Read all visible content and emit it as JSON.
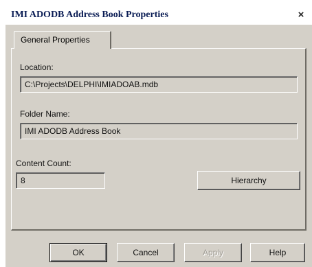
{
  "window": {
    "title": "IMI ADODB Address Book Properties",
    "close_glyph": "×"
  },
  "tabs": [
    {
      "label": "General Properties",
      "selected": true
    }
  ],
  "general": {
    "location_label": "Location:",
    "location_value": "C:\\Projects\\DELPHI\\IMIADOAB.mdb",
    "folder_name_label": "Folder Name:",
    "folder_name_value": "IMI ADODB Address Book",
    "content_count_label": "Content Count:",
    "content_count_value": "8",
    "hierarchy_label": "Hierarchy"
  },
  "buttons": {
    "ok_label": "OK",
    "cancel_label": "Cancel",
    "apply_label": "Apply",
    "help_label": "Help"
  },
  "colors": {
    "dialog_face": "#d4d0c8",
    "title_text": "#0b1d55"
  }
}
